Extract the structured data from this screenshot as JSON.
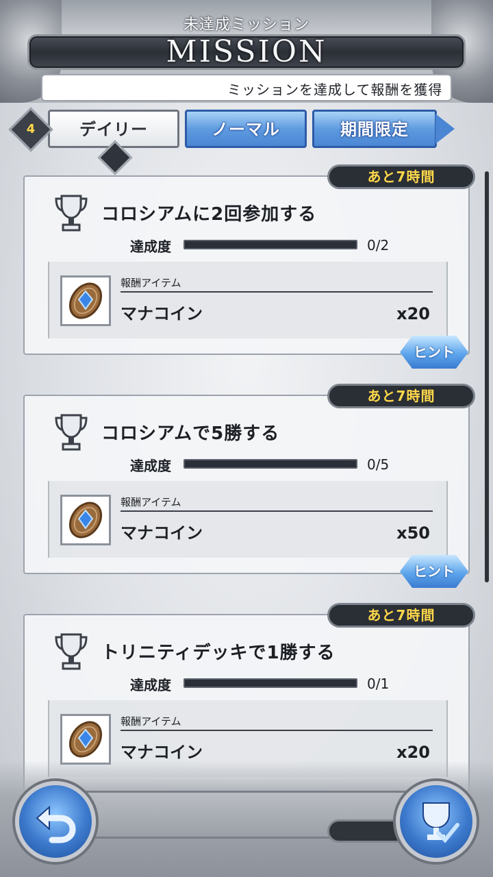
{
  "header": {
    "subtitle": "未達成ミッション",
    "title": "MISSION",
    "ticker": "ミッションを達成して報酬を獲得"
  },
  "tabs": {
    "badge_count": "4",
    "daily": "デイリー",
    "normal": "ノーマル",
    "limited": "期間限定"
  },
  "missions": [
    {
      "timer": "あと7時間",
      "title": "コロシアムに2回参加する",
      "progress_label": "達成度",
      "progress_text": "0/2",
      "progress_fraction": 0,
      "reward_header": "報酬アイテム",
      "reward_name": "マナコイン",
      "reward_qty": "x20",
      "hint": "ヒント"
    },
    {
      "timer": "あと7時間",
      "title": "コロシアムで5勝する",
      "progress_label": "達成度",
      "progress_text": "0/5",
      "progress_fraction": 0,
      "reward_header": "報酬アイテム",
      "reward_name": "マナコイン",
      "reward_qty": "x50",
      "hint": "ヒント"
    },
    {
      "timer": "あと7時間",
      "title": "トリニティデッキで1勝する",
      "progress_label": "達成度",
      "progress_text": "0/1",
      "progress_fraction": 0,
      "reward_header": "報酬アイテム",
      "reward_name": "マナコイン",
      "reward_qty": "x20",
      "hint": ""
    }
  ],
  "icons": {
    "trophy": "trophy-icon",
    "coin": "mana-coin-icon",
    "back": "back-arrow-icon",
    "missions_button": "trophy-check-icon"
  },
  "colors": {
    "timer_text": "#ffd84a",
    "tab_active_blue": "#5f9be0",
    "progress_track": "#2b2f37"
  }
}
